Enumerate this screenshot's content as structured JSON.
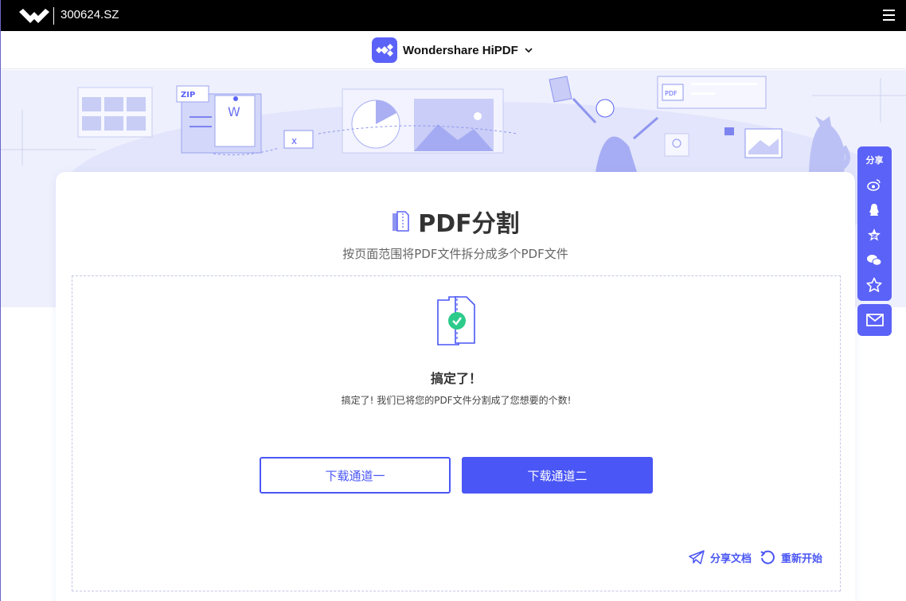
{
  "topbar": {
    "ticker": "300624.SZ",
    "logo_icon": "wondershare-logo-icon",
    "menu_icon": "hamburger-menu-icon"
  },
  "brand": {
    "name": "Wondershare HiPDF",
    "icon": "hipdf-logo-icon",
    "chevron_icon": "chevron-down-icon"
  },
  "hero": {
    "badges": [
      "ZIP",
      "W",
      "PDF"
    ]
  },
  "tool": {
    "icon": "pdf-split-icon",
    "title": "PDF分割",
    "subtitle": "按页面范围将PDF文件拆分成多个PDF文件"
  },
  "result": {
    "icon": "split-document-success-icon",
    "title": "搞定了！",
    "description": "搞定了! 我们已将您的PDF文件分割成了您想要的个数!"
  },
  "buttons": {
    "download_one": "下载通道一",
    "download_two": "下载通道二"
  },
  "actions": {
    "share_doc": "分享文档",
    "restart": "重新开始"
  },
  "share_panel": {
    "title": "分享",
    "icons": [
      "weibo-icon",
      "qq-icon",
      "qzone-icon",
      "wechat-icon",
      "favorite-star-icon"
    ],
    "mail_icon": "mail-icon"
  },
  "colors": {
    "accent": "#4a56f5",
    "brand": "#5b62f7",
    "hero_bg": "#eef0fd",
    "success": "#2ccb8b"
  }
}
